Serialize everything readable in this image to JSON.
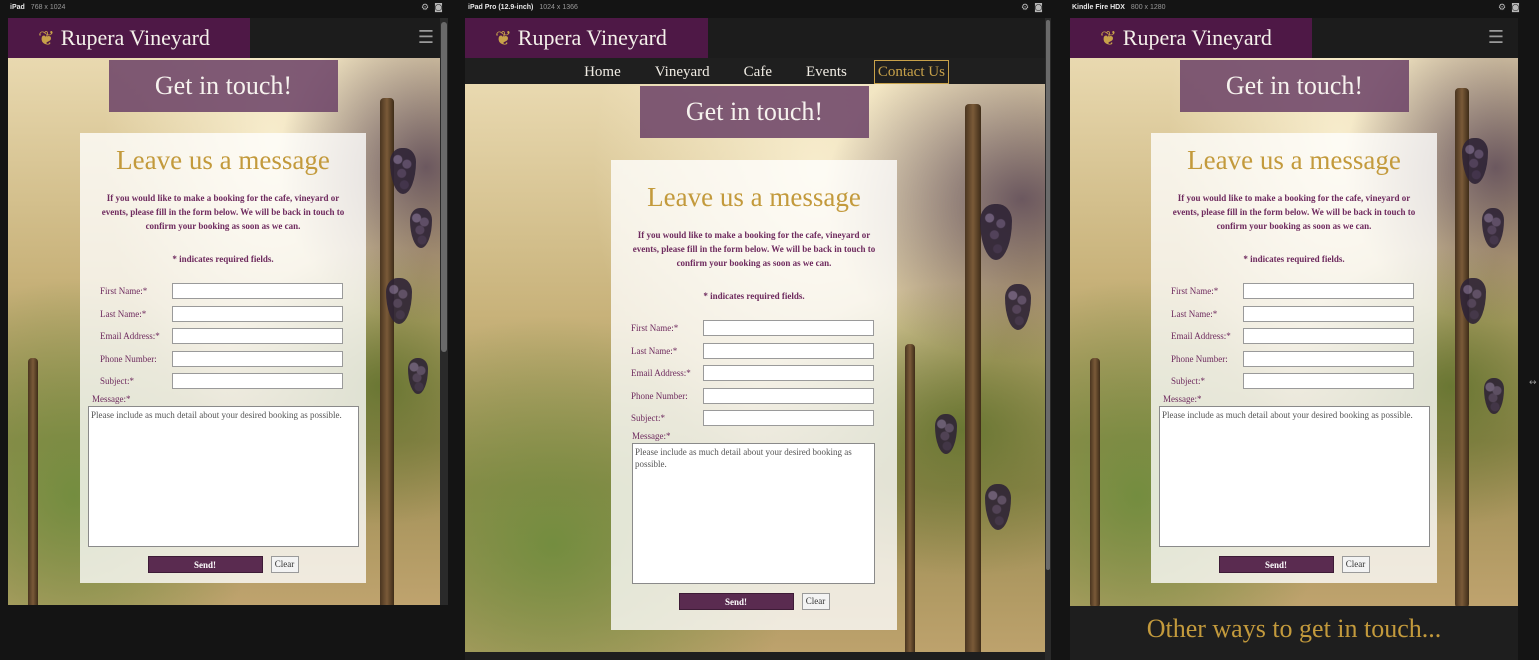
{
  "devices": [
    {
      "name": "iPad",
      "size": "768 x 1024"
    },
    {
      "name": "iPad Pro (12.9-inch)",
      "size": "1024 x 1366"
    },
    {
      "name": "Kindle Fire HDX",
      "size": "800 x 1280"
    }
  ],
  "icons": {
    "settings": "⚙",
    "screenshot": "◙",
    "hamburger": "☰",
    "logo": "❦",
    "resize": "↔"
  },
  "site": {
    "brand": "Rupera Vineyard",
    "nav": [
      "Home",
      "Vineyard",
      "Cafe",
      "Events",
      "Contact Us"
    ],
    "hero": "Get in touch!",
    "form": {
      "title": "Leave us a message",
      "intro": "If you would like to make a booking for the cafe, vineyard or events, please fill in the form below. We will be back in touch to confirm your booking as soon as we can.",
      "required_note": "* indicates required fields.",
      "fields": {
        "first_name": "First Name:*",
        "last_name": "Last Name:*",
        "email": "Email Address:*",
        "phone": "Phone Number:",
        "subject": "Subject:*"
      },
      "message_label": "Message:*",
      "message_placeholder": "Please include as much detail about your desired booking as possible.",
      "send": "Send!",
      "clear": "Clear"
    },
    "other_ways": "Other ways to get in touch..."
  },
  "colors": {
    "brand_bg": "#4e1846",
    "gold": "#c39a3c",
    "plum": "#6e2a5e",
    "send_bg": "#5a2b50"
  }
}
